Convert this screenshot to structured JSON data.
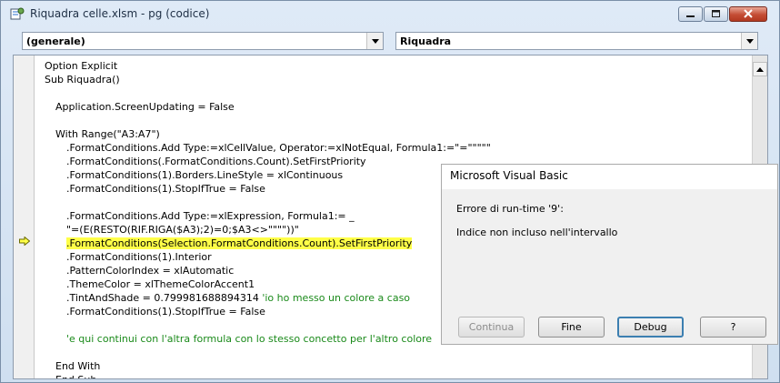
{
  "window": {
    "title": "Riquadra celle.xlsm - pg (codice)"
  },
  "toolbar": {
    "object_combo": "(generale)",
    "procedure_combo": "Riquadra"
  },
  "code": {
    "lines": [
      {
        "text": "Option Explicit",
        "indent": 0,
        "kind": "code"
      },
      {
        "text": "Sub Riquadra()",
        "indent": 0,
        "kind": "code"
      },
      {
        "text": "",
        "indent": 0,
        "kind": "code"
      },
      {
        "text": "Application.ScreenUpdating = False",
        "indent": 1,
        "kind": "code"
      },
      {
        "text": "",
        "indent": 0,
        "kind": "code"
      },
      {
        "text": "With Range(\"A3:A7\")",
        "indent": 1,
        "kind": "code"
      },
      {
        "text": ".FormatConditions.Add Type:=xlCellValue, Operator:=xlNotEqual, Formula1:=\"=\"\"\"\"\"",
        "indent": 2,
        "kind": "code"
      },
      {
        "text": ".FormatConditions(.FormatConditions.Count).SetFirstPriority",
        "indent": 2,
        "kind": "code"
      },
      {
        "text": ".FormatConditions(1).Borders.LineStyle = xlContinuous",
        "indent": 2,
        "kind": "code"
      },
      {
        "text": ".FormatConditions(1).StopIfTrue = False",
        "indent": 2,
        "kind": "code"
      },
      {
        "text": "",
        "indent": 0,
        "kind": "code"
      },
      {
        "text": ".FormatConditions.Add Type:=xlExpression, Formula1:= _",
        "indent": 2,
        "kind": "code"
      },
      {
        "text": "\"=(E(RESTO(RIF.RIGA($A3);2)=0;$A3<>\"\"\"\"))\"",
        "indent": 2,
        "kind": "code"
      },
      {
        "text": ".FormatConditions(Selection.FormatConditions.Count).SetFirstPriority",
        "indent": 2,
        "kind": "highlight"
      },
      {
        "text": ".FormatConditions(1).Interior",
        "indent": 2,
        "kind": "code"
      },
      {
        "text": ".PatternColorIndex = xlAutomatic",
        "indent": 2,
        "kind": "code"
      },
      {
        "text": ".ThemeColor = xlThemeColorAccent1",
        "indent": 2,
        "kind": "code"
      },
      {
        "text": ".TintAndShade = 0.799981688894314 ",
        "indent": 2,
        "kind": "code",
        "comment": "'io ho messo un colore a caso"
      },
      {
        "text": ".FormatConditions(1).StopIfTrue = False",
        "indent": 2,
        "kind": "code"
      },
      {
        "text": "",
        "indent": 0,
        "kind": "code"
      },
      {
        "text": "",
        "indent": 2,
        "kind": "code",
        "comment": "'e qui continui con l'altra formula con lo stesso concetto per l'altro colore"
      },
      {
        "text": "",
        "indent": 0,
        "kind": "code"
      },
      {
        "text": "End With",
        "indent": 1,
        "kind": "code"
      },
      {
        "text": "End Sub",
        "indent": 1,
        "kind": "code"
      }
    ]
  },
  "dialog": {
    "title": "Microsoft Visual Basic",
    "error_line": "Errore di run-time '9':",
    "message": "Indice non incluso nell'intervallo",
    "buttons": {
      "continue": "Continua",
      "end": "Fine",
      "debug": "Debug",
      "help": "?"
    }
  },
  "colors": {
    "highlight": "#ffff48",
    "comment": "#1a8a1a"
  }
}
